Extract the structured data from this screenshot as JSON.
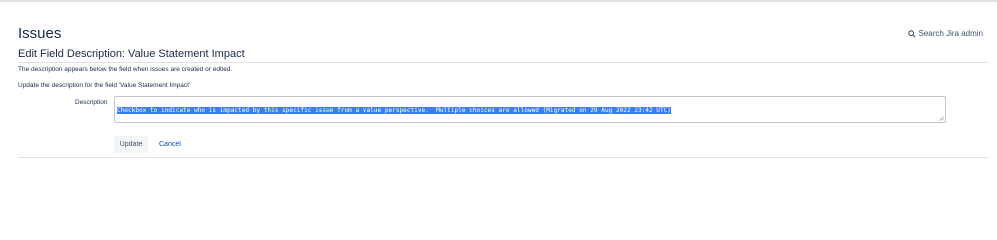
{
  "header": {
    "title": "Issues",
    "search_label": "Search Jira admin"
  },
  "form": {
    "section_title": "Edit Field Description: Value Statement Impact",
    "help_text": "The description appears below the field when issues are created or edited.",
    "instruction": "Update the description for the field 'Value Statement Impact'",
    "field_label": "Description",
    "field_value": "Checkbox to indicate who is impacted by this specific issue from a value perspective.  Multiple choices are allowed (Migrated on 29 Aug 2022 23:42 UTC)",
    "update_label": "Update",
    "cancel_label": "Cancel"
  },
  "colors": {
    "text": "#172b4d",
    "link": "#0052cc",
    "selection": "#3a7bff",
    "divider": "#dfe1e6"
  }
}
